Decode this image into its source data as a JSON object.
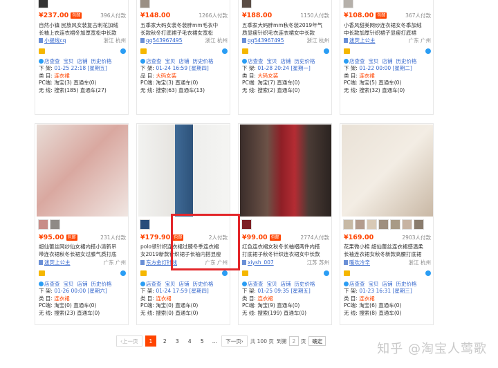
{
  "colors": {
    "accent": "#ff4400",
    "link": "#3366cc",
    "highlight": "#e3262a"
  },
  "cards": [
    {
      "price": "¥237.00",
      "tag": "包邮",
      "sold": "396人付款",
      "title_a": "自然小镇 民族风女装复古刺花加绒",
      "title_b": "长袖上衣连衣裙冬加厚宽松中长款",
      "title_hl": "连衣裙",
      "shop": "小提线cq",
      "loc": "浙江 杭州",
      "links": [
        "店查查",
        "宝贝",
        "店铺",
        "历史价格"
      ],
      "listed_label": "下 架:",
      "listed": "01-25 22:18 [星期五]",
      "cat_label": "类 目:",
      "category": "连衣裙",
      "pc_label": "PC端:",
      "pc": "淘宝(3)",
      "pc2": "直通车(0)",
      "wl_label": "无 线:",
      "wl": "搜索(185)",
      "wl2": "直通车(27)"
    },
    {
      "price": "¥148.00",
      "tag": "",
      "sold": "1266人付款",
      "title_a": "五季家大码女装冬装胖mm毛衣中",
      "title_b": "长款秋冬打底裙子毛衣裙女宽松",
      "title_hl": "连衣裙",
      "shop": "qq543967495",
      "loc": "浙江 杭州",
      "links": [
        "店查查",
        "宝贝",
        "店铺",
        "历史价格"
      ],
      "listed_label": "下 架:",
      "listed": "01-24 16:59 [星期四]",
      "cat_label": "品 目:",
      "category": "大码女装",
      "pc_label": "PC端:",
      "pc": "淘宝(3)",
      "pc2": "直通车(0)",
      "wl_label": "无 线:",
      "wl": "搜索(63)",
      "wl2": "直通车(13)"
    },
    {
      "price": "¥188.00",
      "tag": "",
      "sold": "1150人付款",
      "title_a": "五季家大码胖mm秋冬装2019年气",
      "title_b": "质显瘦针织毛衣连衣裙女中长款",
      "title_hl": "连衣裙",
      "shop": "qq543967495",
      "loc": "浙江 杭州",
      "links": [
        "店查查",
        "宝贝",
        "店铺",
        "历史价格"
      ],
      "listed_label": "下 架:",
      "listed": "01-28 20:24 [星期一]",
      "cat_label": "类 目:",
      "category": "大码女装",
      "pc_label": "PC端:",
      "pc": "淘宝(7)",
      "pc2": "直通车(0)",
      "wl_label": "无 线:",
      "wl": "搜索(2)",
      "wl2": "直通车(0)"
    },
    {
      "price": "¥108.00",
      "tag": "包邮",
      "sold": "367人付款",
      "title_a": "小香风甜美网纱连衣裙女冬季加绒",
      "title_b": "中长款加厚针织裙子显瘦打底裙",
      "title_hl": "连衣裙",
      "shop": "迷荧上公主",
      "loc": "广东 广州",
      "links": [
        "店查查",
        "宝贝",
        "店铺",
        "历史价格"
      ],
      "listed_label": "下 架:",
      "listed": "01-22 00:00 [星期二]",
      "cat_label": "类 目:",
      "category": "连衣裙",
      "pc_label": "PC端:",
      "pc": "淘宝(5)",
      "pc2": "直通车(0)",
      "wl_label": "无 线:",
      "wl": "搜索(32)",
      "wl2": "直通车(0)"
    },
    {
      "price": "¥95.00",
      "tag": "包邮",
      "sold": "231人付款",
      "title_a": "超仙蕾丝网纱仙女裙内搭小清新吊",
      "title_b": "带连衣裙秋冬长裙女过膝气质打底",
      "title_hl": "连衣裙",
      "shop": "迷荧上公主",
      "loc": "广东 广州",
      "links": [
        "店查查",
        "宝贝",
        "店铺",
        "历史价格"
      ],
      "listed_label": "下 架:",
      "listed": "01-26 00:00 [星期六]",
      "cat_label": "类 目:",
      "category": "连衣裙",
      "pc_label": "PC端:",
      "pc": "淘宝(0)",
      "pc2": "直通车(0)",
      "wl_label": "无 线:",
      "wl": "搜索(23)",
      "wl2": "直通车(0)"
    },
    {
      "price": "¥179.90",
      "tag": "包邮",
      "sold": "2人付款",
      "title_a": "polo领针织连衣裙过膝冬季连衣裙",
      "title_b": "女2019新款针织裙子长袖内搭显瘦",
      "title_hl": "连衣裙",
      "shop": "东方金灯针线",
      "loc": "广东 广州",
      "links": [
        "店查查",
        "宝贝",
        "店铺",
        "历史价格"
      ],
      "listed_label": "下 架:",
      "listed": "01-24 17:59 [星期四]",
      "cat_label": "类 目:",
      "category": "连衣裙",
      "pc_label": "PC端:",
      "pc": "淘宝(0)",
      "pc2": "直通车(0)",
      "wl_label": "无 线:",
      "wl": "搜索(0)",
      "wl2": "直通车(0)"
    },
    {
      "price": "¥99.00",
      "tag": "包邮",
      "sold": "2774人付款",
      "title_a": "红色连衣裙女秋冬长袖褶两件内搭",
      "title_b": "打底裙子秋冬针织连衣裙女中长款",
      "title_hl": "连衣裙",
      "shop": "xiysh_007",
      "loc": "江苏 苏州",
      "links": [
        "店查查",
        "宝贝",
        "店铺",
        "历史价格"
      ],
      "listed_label": "下 架:",
      "listed": "01-25 09:35 [星期五]",
      "cat_label": "类 目:",
      "category": "连衣裙",
      "pc_label": "PC端:",
      "pc": "淘宝(9)",
      "pc2": "直通车(0)",
      "wl_label": "无 线:",
      "wl": "搜索(199)",
      "wl2": "直通车(0)"
    },
    {
      "price": "¥169.00",
      "tag": "",
      "sold": "2903人付款",
      "title_a": "花果微小棉 超仙蕾丝连衣裙感温柔",
      "title_b": "长袖连衣裙女秋冬新款高腰打底裙",
      "title_hl": "连衣裙",
      "shop": "暖欢冷辛",
      "loc": "浙江 杭州",
      "links": [
        "店查查",
        "宝贝",
        "店铺",
        "历史价格"
      ],
      "listed_label": "下 架:",
      "listed": "01-23 16:31 [星期三]",
      "cat_label": "类 目:",
      "category": "连衣裙",
      "pc_label": "PC端:",
      "pc": "淘宝(6)",
      "pc2": "直通车(0)",
      "wl_label": "无 线:",
      "wl": "搜索(8)",
      "wl2": "直通车(0)"
    }
  ],
  "pager": {
    "prev": "‹上一页",
    "pages": [
      "1",
      "2",
      "3",
      "4",
      "5",
      "..."
    ],
    "next": "下一页›",
    "total_label": "共 100 页",
    "goto_label": "到第",
    "goto_value": "2",
    "page_unit": "页",
    "ok": "确定"
  },
  "watermark": "知乎 @淘宝人莺歌"
}
